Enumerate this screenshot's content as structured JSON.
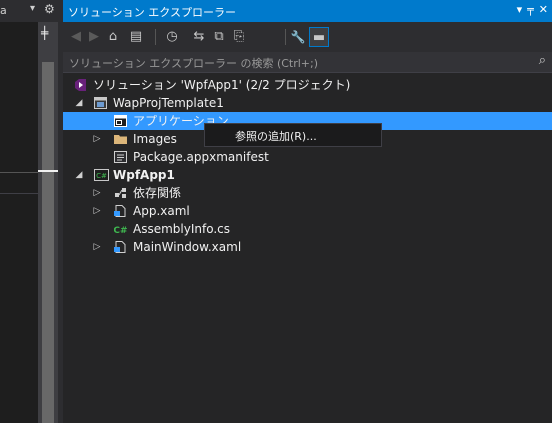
{
  "left_panel": {
    "clipped_title": "a",
    "dropdown_glyph": "▾",
    "settings_glyph": "⚙",
    "split_glyph": "╪"
  },
  "solution_explorer": {
    "title": "ソリューション エクスプローラー",
    "title_icons": {
      "dropdown": "▾",
      "pin": "╤",
      "close": "✕"
    },
    "toolbar": [
      {
        "name": "back-icon",
        "glyph": "◀"
      },
      {
        "name": "forward-icon",
        "glyph": "▶"
      },
      {
        "name": "home-icon",
        "glyph": "⌂"
      },
      {
        "name": "switch-views-icon",
        "glyph": "▤"
      },
      {
        "name": "pending-changes-icon",
        "glyph": "◷"
      },
      {
        "name": "sync-icon",
        "glyph": "⇆"
      },
      {
        "name": "collapse-all-icon",
        "glyph": "⧉"
      },
      {
        "name": "show-all-files-icon",
        "glyph": "⎘"
      },
      {
        "name": "properties-icon",
        "glyph": "🔧"
      },
      {
        "name": "preview-icon",
        "glyph": "▬"
      }
    ],
    "search_placeholder": "ソリューション エクスプローラー の検索 (Ctrl+;)",
    "search_icon": "⌕",
    "tree": [
      {
        "label": "ソリューション 'WpfApp1' (2/2 プロジェクト)",
        "icon": "solution-icon"
      },
      {
        "label": "WapProjTemplate1",
        "icon": "package-project-icon",
        "expander": "◢"
      },
      {
        "label": "アプリケーション",
        "icon": "application-icon",
        "selected": true
      },
      {
        "label": "Images",
        "icon": "folder-icon",
        "expander": "▷"
      },
      {
        "label": "Package.appxmanifest",
        "icon": "manifest-icon"
      },
      {
        "label": "WpfApp1",
        "icon": "csharp-project-icon",
        "expander": "◢",
        "bold": true
      },
      {
        "label": "依存関係",
        "icon": "dependencies-icon",
        "expander": "▷"
      },
      {
        "label": "App.xaml",
        "icon": "xaml-file-icon",
        "expander": "▷"
      },
      {
        "label": "AssemblyInfo.cs",
        "icon": "csharp-file-icon"
      },
      {
        "label": "MainWindow.xaml",
        "icon": "xaml-file-icon",
        "expander": "▷"
      }
    ],
    "context_menu": {
      "item": "参照の追加(R)..."
    }
  },
  "colors": {
    "accent": "#007acc",
    "selection": "#3399ff",
    "background": "#252526",
    "folder": "#dcb67a",
    "csharp": "#68217a"
  }
}
